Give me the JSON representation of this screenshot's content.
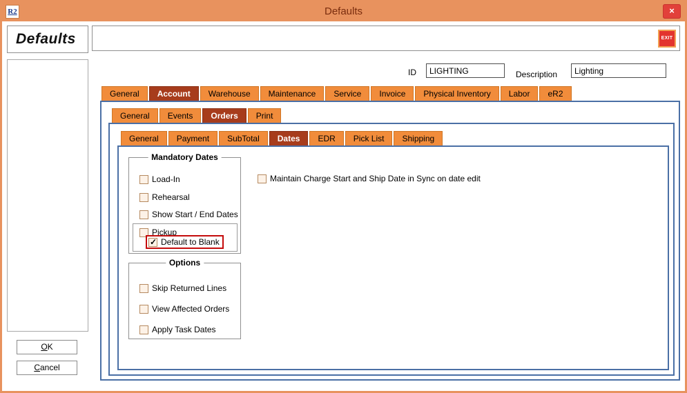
{
  "window": {
    "title": "Defaults",
    "app_icon": "R2",
    "close_glyph": "×"
  },
  "sidebar": {
    "title": "Defaults",
    "ok_label": "OK",
    "cancel_label": "Cancel"
  },
  "header": {
    "exit_label": "EXIT",
    "id_label": "ID",
    "id_value": "LIGHTING",
    "description_label": "Description",
    "description_value": "Lighting"
  },
  "tabs_level1": {
    "items": [
      {
        "label": "General",
        "selected": false
      },
      {
        "label": "Account",
        "selected": true
      },
      {
        "label": "Warehouse",
        "selected": false
      },
      {
        "label": "Maintenance",
        "selected": false
      },
      {
        "label": "Service",
        "selected": false
      },
      {
        "label": "Invoice",
        "selected": false
      },
      {
        "label": "Physical Inventory",
        "selected": false
      },
      {
        "label": "Labor",
        "selected": false
      },
      {
        "label": "eR2",
        "selected": false
      }
    ]
  },
  "tabs_level2": {
    "items": [
      {
        "label": "General",
        "selected": false
      },
      {
        "label": "Events",
        "selected": false
      },
      {
        "label": "Orders",
        "selected": true
      },
      {
        "label": "Print",
        "selected": false
      }
    ]
  },
  "tabs_level3": {
    "items": [
      {
        "label": "General",
        "selected": false
      },
      {
        "label": "Payment",
        "selected": false
      },
      {
        "label": "SubTotal",
        "selected": false
      },
      {
        "label": "Dates",
        "selected": true
      },
      {
        "label": "EDR",
        "selected": false
      },
      {
        "label": "Pick List",
        "selected": false
      },
      {
        "label": "Shipping",
        "selected": false
      }
    ]
  },
  "content": {
    "mandatory_dates": {
      "legend": "Mandatory Dates",
      "checkboxes": [
        {
          "label": "Load-In",
          "checked": false
        },
        {
          "label": "Rehearsal",
          "checked": false
        },
        {
          "label": "Show Start / End Dates",
          "checked": false
        },
        {
          "label": "Pickup",
          "checked": false
        },
        {
          "label": "Default to Blank",
          "checked": true,
          "highlighted": true
        }
      ]
    },
    "sync_checkbox": {
      "label": "Maintain Charge Start and Ship Date in Sync on date edit",
      "checked": false
    },
    "options": {
      "legend": "Options",
      "checkboxes": [
        {
          "label": "Skip Returned Lines",
          "checked": false
        },
        {
          "label": "View Affected Orders",
          "checked": false
        },
        {
          "label": "Apply Task Dates",
          "checked": false
        }
      ]
    }
  },
  "colors": {
    "titlebar": "#e8925e",
    "tab": "#f18c3b",
    "tab_selected": "#a73c1c",
    "panel_border": "#4a6fa5",
    "highlight": "#c40a0a",
    "exit_red": "#e3342e"
  }
}
